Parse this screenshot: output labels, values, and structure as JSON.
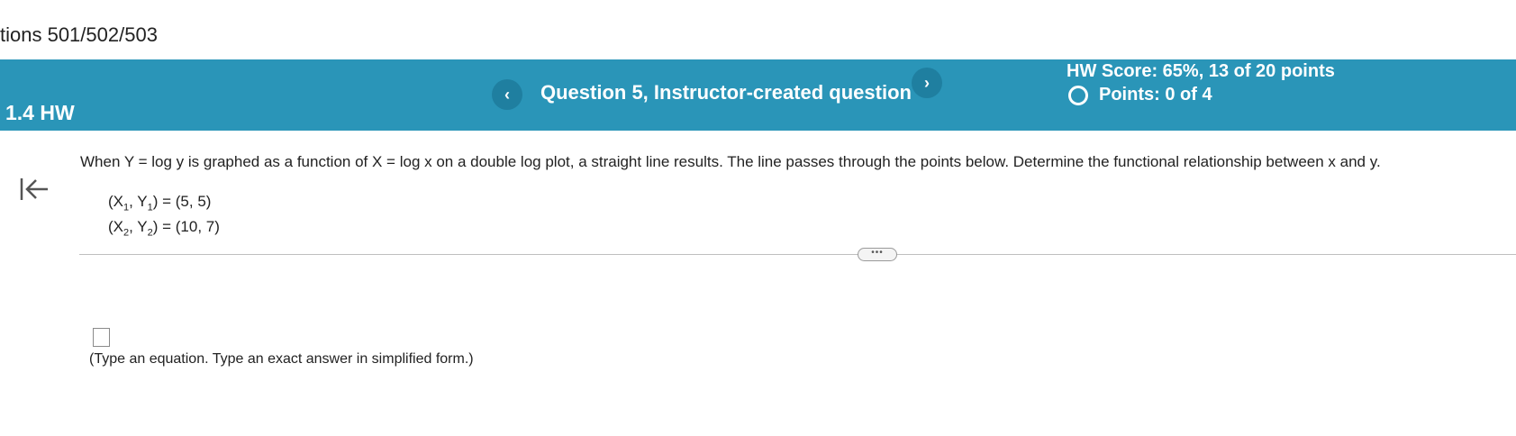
{
  "course": {
    "title": "tions 501/502/503"
  },
  "header": {
    "hw_label": "1.4 HW",
    "prev_label": "‹",
    "next_label": "›",
    "question_title": "Question 5, Instructor-created question",
    "hw_score": "HW Score: 65%, 13 of 20 points",
    "points": "Points: 0 of 4"
  },
  "problem": {
    "text": "When Y = log y is graphed as a function of X = log  x on a double log plot, a straight line results. The line passes through the points below. Determine the functional relationship between x and y.",
    "points": [
      {
        "prefix": "(X",
        "sub1": "1",
        "mid": ", Y",
        "sub2": "1",
        "suffix": ") = (5, 5)"
      },
      {
        "prefix": "(X",
        "sub1": "2",
        "mid": ", Y",
        "sub2": "2",
        "suffix": ") = (10, 7)"
      }
    ],
    "more_label": "•••"
  },
  "answer": {
    "hint": "(Type an equation. Type an exact answer in simplified form.)"
  },
  "icons": {
    "back": "back-to-start-icon",
    "status": "circle-icon"
  },
  "colors": {
    "header_bg": "#2a95b8",
    "nav_button": "#1f7fa0"
  }
}
